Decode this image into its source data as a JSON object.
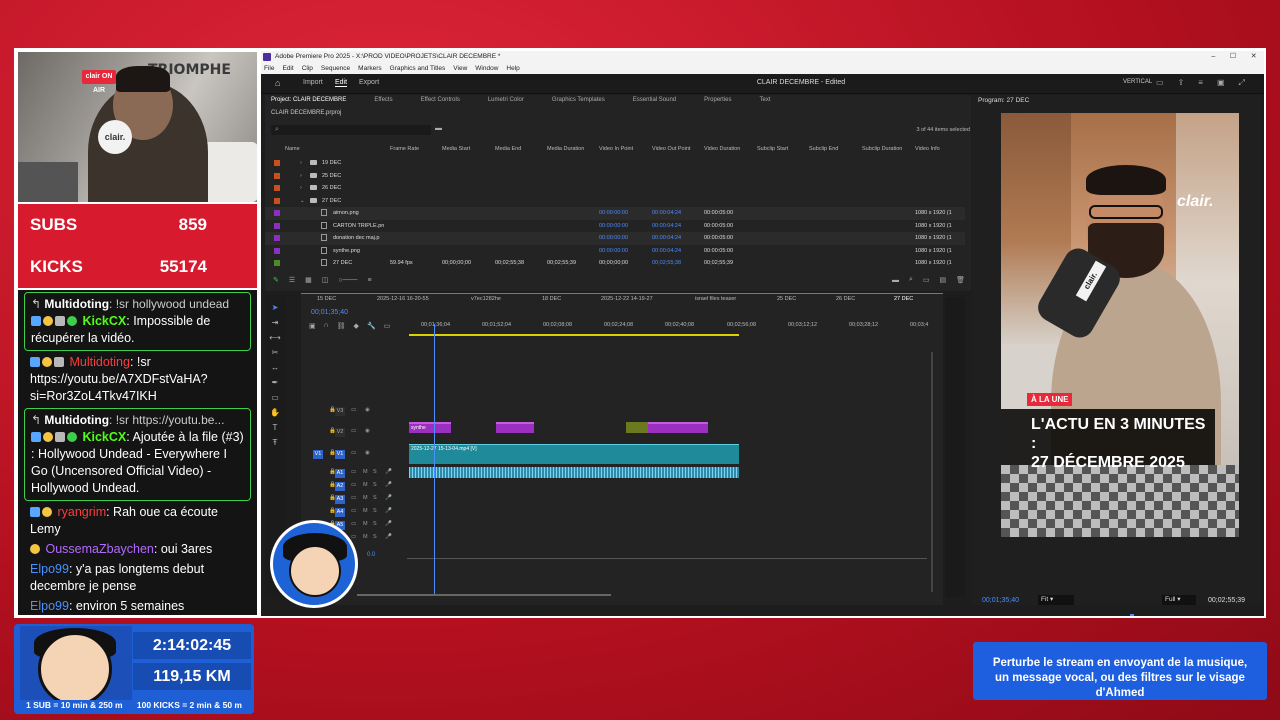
{
  "webcam": {
    "sign_text": "TRIOMPHE",
    "onair": "clair ON AIR",
    "mic_label": "clair."
  },
  "counters": {
    "subs_label": "SUBS",
    "subs_value": "859",
    "kicks_label": "KICKS",
    "kicks_value": "55174"
  },
  "chat": {
    "messages": [
      {
        "reply_to_user": "Multidoting",
        "reply_to_text": ": !sr hollywood undead",
        "user": "KickCX",
        "text": ": Impossible de récupérer la vidéo."
      },
      {
        "user": "Multidoting",
        "text": ": !sr https://youtu.be/A7XDFstVaHA?si=Ror3ZoL4Tkv47IKH"
      },
      {
        "reply_to_user": "Multidoting",
        "reply_to_text": ": !sr https://youtu.be...",
        "user": "KickCX",
        "text": ": Ajoutée à la file (#3) : Hollywood Undead - Everywhere I Go (Uncensored Official Video) - Hollywood Undead."
      },
      {
        "user": "ryangrim",
        "text": ": Rah oue ca écoute Lemy"
      },
      {
        "user": "OussemaZbaychen",
        "text": ": oui 3ares"
      },
      {
        "user": "Elpo99",
        "text": ": y'a pas longtems debut decembre je pense"
      },
      {
        "user": "Elpo99",
        "text": ": environ 5 semaines"
      }
    ]
  },
  "stats": {
    "timer": "2:14:02:45",
    "distance": "119,15 KM",
    "rule_subs": "1 SUB = 10 min & 250 m",
    "rule_kicks": "100 KICKS = 2 min & 50 m"
  },
  "banner": {
    "line1": "Perturbe le stream en envoyant de la musique,",
    "line2": "un message vocal, ou des filtres sur le visage d'Ahmed"
  },
  "premiere": {
    "window_title": "Adobe Premiere Pro 2025 - X:\\PROD VIDEO\\PROJETS\\CLAIR DECEMBRE *",
    "window_controls": [
      "–",
      "☐",
      "✕"
    ],
    "menu": [
      "File",
      "Edit",
      "Clip",
      "Sequence",
      "Markers",
      "Graphics and Titles",
      "View",
      "Window",
      "Help"
    ],
    "top_tabs": {
      "import": "Import",
      "edit": "Edit",
      "export": "Export"
    },
    "project_title": "CLAIR DECEMBRE - Edited",
    "layout_label": "VERTICAL",
    "panel_tabs": [
      "Project: CLAIR DECEMBRE",
      "Effects",
      "Effect Controls",
      "Lumetri Color",
      "Graphics Templates",
      "Essential Sound",
      "Properties",
      "Text"
    ],
    "project_file": "CLAIR DECEMBRE.prproj",
    "items_selected": "3 of 44 items selected",
    "columns": [
      "Name",
      "Frame Rate",
      "Media Start",
      "Media End",
      "Media Duration",
      "Video In Point",
      "Video Out Point",
      "Video Duration",
      "Subclip Start",
      "Subclip End",
      "Subclip Duration",
      "Video Info"
    ],
    "rows": [
      {
        "name": "19 DEC",
        "color": "#c8501e",
        "folder": true
      },
      {
        "name": "25 DEC",
        "color": "#c8501e",
        "folder": true
      },
      {
        "name": "26 DEC",
        "color": "#c8501e",
        "folder": true
      },
      {
        "name": "27 DEC",
        "color": "#c8501e",
        "folder": true
      },
      {
        "name": "aimon.png",
        "color": "#8a2fbf",
        "in": "00:00:00:00",
        "out": "00:00:04:24",
        "dur": "00:00:05:00",
        "info": "1080 x 1920 (1"
      },
      {
        "name": "CARTON TRIPLE.pn",
        "color": "#8a2fbf",
        "in": "00:00:00:00",
        "out": "00:00:04:24",
        "dur": "00:00:05:00",
        "info": "1080 x 1920 (1"
      },
      {
        "name": "donation dec maj.p",
        "color": "#8a2fbf",
        "in": "00:00:00:00",
        "out": "00:00:04:24",
        "dur": "00:00:05:00",
        "info": "1080 x 1920 (1"
      },
      {
        "name": "synthe.png",
        "color": "#8a2fbf",
        "in": "00:00:00:00",
        "out": "00:00:04:24",
        "dur": "00:00:05:00",
        "info": "1080 x 1920 (1"
      },
      {
        "name": "27 DEC",
        "color": "#4f8a2a",
        "fps": "59.94 fps",
        "mstart": "00;00;00;00",
        "mend": "00;02;55;38",
        "mdur": "00;02;55;39",
        "in": "00;00;00;00",
        "out": "00;02;55;38",
        "dur": "00;02;55;39",
        "info": "1080 x 1920 (1"
      }
    ],
    "program_title": "Program: 27 DEC",
    "program_tc_current": "00;01;35;40",
    "program_fit": "Fit",
    "program_quality": "Full",
    "program_tc_total": "00;02;55;39",
    "video_tag": "À LA UNE",
    "video_headline_1": "L'ACTU EN 3 MINUTES :",
    "video_headline_2": "27 DÉCEMBRE 2025",
    "video_brand": "clair.",
    "seq_tabs": [
      "15 DEC",
      "2025-12-16 16-20-55",
      "v7ec1282he",
      "18 DEC",
      "2025-12-22 14-19-27",
      "israel files teaser",
      "25 DEC",
      "26 DEC",
      "27 DEC"
    ],
    "timeline_tc": "00;01;35;40",
    "ruler": [
      "00;01;36;04",
      "00;01;52;04",
      "00;02;08;08",
      "00;02;24;08",
      "00;02;40;08",
      "00;02;56;08",
      "00;03;12;12",
      "00;03;28;12",
      "00;03;4"
    ],
    "tracks_video": [
      "V3",
      "V2",
      "V1"
    ],
    "tracks_audio": [
      "A1",
      "A2",
      "A3",
      "A4",
      "A5",
      "A6"
    ],
    "clip_synthe": "synthe",
    "clip_v1": "2025-12-27 15-13-04.mp4 [V]",
    "mix_value": "0.0"
  }
}
